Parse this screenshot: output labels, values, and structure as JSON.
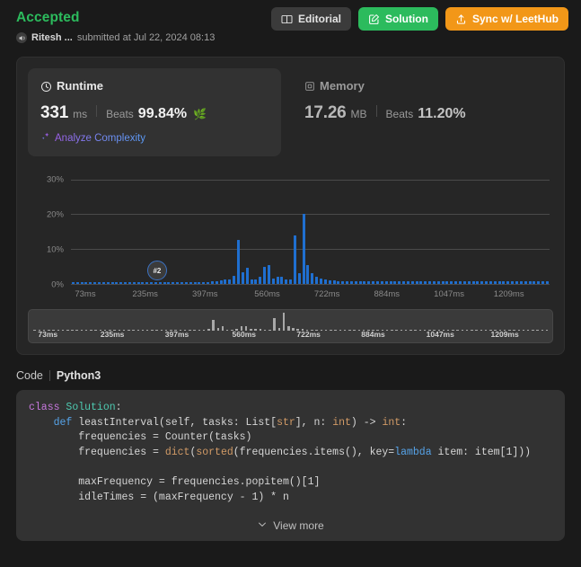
{
  "header": {
    "status": "Accepted",
    "username": "Ritesh ...",
    "submitted": "submitted at Jul 22, 2024 08:13",
    "buttons": [
      {
        "label": "Editorial",
        "icon": "book-icon",
        "color": "#3b3b3b"
      },
      {
        "label": "Solution",
        "icon": "pencil-square-icon",
        "color": "#2cbb5d"
      },
      {
        "label": "Sync w/ LeetHub",
        "icon": "upload-icon",
        "color": "#f29718"
      }
    ],
    "accent_accepted": "#2cbb5d"
  },
  "stats": {
    "runtime": {
      "title": "Runtime",
      "icon": "clock-icon",
      "value": "331",
      "unit": "ms",
      "beats_label": "Beats",
      "beats_value": "99.84%",
      "badge_emoji": "🌿",
      "analyze_label": "Analyze Complexity",
      "analyze_icon": "sparkle-icon"
    },
    "memory": {
      "title": "Memory",
      "icon": "chip-icon",
      "value": "17.26",
      "unit": "MB",
      "beats_label": "Beats",
      "beats_value": "11.20%"
    }
  },
  "chart_data": {
    "type": "bar",
    "title": "",
    "xlabel": "",
    "ylabel": "",
    "ylim": [
      0,
      33
    ],
    "grid": true,
    "legend": false,
    "bar_color": "#1f6fd0",
    "ytick_labels": [
      "0%",
      "10%",
      "20%",
      "30%"
    ],
    "ytick_values": [
      0,
      10,
      20,
      30
    ],
    "xtick_labels": [
      "73ms",
      "235ms",
      "397ms",
      "560ms",
      "722ms",
      "884ms",
      "1047ms",
      "1209ms"
    ],
    "xtick_positions": [
      3.0,
      15.5,
      28.0,
      41.0,
      53.5,
      66.0,
      79.0,
      91.5
    ],
    "marker": {
      "label": "#2",
      "x_percent": 18.0,
      "y_percent": 3.0
    },
    "values": [
      0.6,
      0.6,
      0.6,
      0.6,
      0.6,
      0.6,
      0.6,
      0.6,
      0.6,
      0.6,
      0.6,
      0.6,
      0.6,
      0.6,
      0.6,
      0.6,
      0.6,
      0.6,
      0.6,
      0.6,
      0.6,
      0.6,
      0.6,
      0.6,
      0.6,
      0.6,
      0.6,
      0.6,
      0.6,
      0.6,
      0.6,
      0.6,
      0.7,
      0.8,
      1.0,
      1.2,
      1.4,
      2.3,
      12.6,
      3.4,
      4.7,
      1.2,
      1.4,
      2.0,
      5.0,
      5.4,
      1.6,
      2.0,
      2.1,
      1.2,
      1.4,
      13.8,
      3.2,
      20.2,
      5.4,
      3.2,
      2.0,
      1.6,
      1.3,
      1.1,
      1.0,
      0.9,
      0.9,
      0.8,
      0.8,
      0.7,
      0.7,
      0.7,
      0.7,
      0.7,
      0.7,
      0.7,
      0.7,
      0.7,
      0.7,
      0.7,
      0.7,
      0.7,
      0.7,
      0.7,
      0.7,
      0.7,
      0.7,
      0.7,
      0.7,
      0.7,
      0.7,
      0.7,
      0.7,
      0.7,
      0.7,
      0.7,
      0.7,
      0.7,
      0.7,
      0.7,
      0.7,
      0.7,
      0.7,
      0.7,
      0.7,
      0.7,
      0.7,
      0.7,
      0.7,
      0.7,
      0.7,
      0.7,
      0.7,
      0.7
    ]
  },
  "minimap": {
    "xtick_labels": [
      "73ms",
      "235ms",
      "397ms",
      "560ms",
      "722ms",
      "884ms",
      "1047ms",
      "1209ms"
    ],
    "xtick_positions": [
      3.0,
      15.5,
      28.0,
      41.0,
      53.5,
      66.0,
      79.0,
      91.5
    ],
    "bar_color": "#a8a8a8",
    "values": [
      0.6,
      0.6,
      0.6,
      0.6,
      0.6,
      0.6,
      0.6,
      0.6,
      0.6,
      0.6,
      0.6,
      0.6,
      0.6,
      0.6,
      0.6,
      0.6,
      0.6,
      0.6,
      0.6,
      0.6,
      0.6,
      0.6,
      0.6,
      0.6,
      0.6,
      0.6,
      0.6,
      0.6,
      0.6,
      0.6,
      0.6,
      0.6,
      0.7,
      0.8,
      1.0,
      1.2,
      1.4,
      2.3,
      12.6,
      3.4,
      4.7,
      1.2,
      1.4,
      2.0,
      5.0,
      5.4,
      1.6,
      2.0,
      2.1,
      1.2,
      1.4,
      13.8,
      3.2,
      20.2,
      5.4,
      3.2,
      2.0,
      1.6,
      1.3,
      1.1,
      1.0,
      0.9,
      0.9,
      0.8,
      0.8,
      0.7,
      0.7,
      0.7,
      0.7,
      0.7,
      0.7,
      0.7,
      0.7,
      0.7,
      0.7,
      0.7,
      0.7,
      0.7,
      0.7,
      0.7,
      0.7,
      0.7,
      0.7,
      0.7,
      0.7,
      0.7,
      0.7,
      0.7,
      0.7,
      0.7,
      0.7,
      0.7,
      0.7,
      0.7,
      0.7,
      0.7,
      0.7,
      0.7,
      0.7,
      0.7,
      0.7,
      0.7,
      0.7,
      0.7,
      0.7,
      0.7,
      0.7,
      0.7,
      0.7,
      0.7
    ]
  },
  "code_section": {
    "label": "Code",
    "language": "Python3",
    "view_more_label": "View more",
    "view_more_icon": "chevron-down-icon",
    "lines": [
      [
        {
          "t": "class ",
          "c": "tok-kw"
        },
        {
          "t": "Solution",
          "c": "tok-cls"
        },
        {
          "t": ":",
          "c": "tok-plain"
        }
      ],
      [
        {
          "t": "    ",
          "c": "tok-plain"
        },
        {
          "t": "def ",
          "c": "tok-kw2"
        },
        {
          "t": "leastInterval",
          "c": "tok-fn"
        },
        {
          "t": "(self, tasks: List[",
          "c": "tok-plain"
        },
        {
          "t": "str",
          "c": "tok-type"
        },
        {
          "t": "], n: ",
          "c": "tok-plain"
        },
        {
          "t": "int",
          "c": "tok-type"
        },
        {
          "t": ") -> ",
          "c": "tok-plain"
        },
        {
          "t": "int",
          "c": "tok-type"
        },
        {
          "t": ":",
          "c": "tok-plain"
        }
      ],
      [
        {
          "t": "        frequencies = Counter(tasks)",
          "c": "tok-plain"
        }
      ],
      [
        {
          "t": "        frequencies = ",
          "c": "tok-plain"
        },
        {
          "t": "dict",
          "c": "tok-builtin"
        },
        {
          "t": "(",
          "c": "tok-plain"
        },
        {
          "t": "sorted",
          "c": "tok-builtin"
        },
        {
          "t": "(frequencies.items(), key=",
          "c": "tok-plain"
        },
        {
          "t": "lambda",
          "c": "tok-kw2"
        },
        {
          "t": " item: item[",
          "c": "tok-plain"
        },
        {
          "t": "1",
          "c": "tok-num"
        },
        {
          "t": "]))",
          "c": "tok-plain"
        }
      ],
      [
        {
          "t": "",
          "c": "tok-plain"
        }
      ],
      [
        {
          "t": "        maxFrequency = frequencies.popitem()[",
          "c": "tok-plain"
        },
        {
          "t": "1",
          "c": "tok-num"
        },
        {
          "t": "]",
          "c": "tok-plain"
        }
      ],
      [
        {
          "t": "        idleTimes = (maxFrequency - ",
          "c": "tok-plain"
        },
        {
          "t": "1",
          "c": "tok-num"
        },
        {
          "t": ") * n",
          "c": "tok-plain"
        }
      ]
    ]
  }
}
